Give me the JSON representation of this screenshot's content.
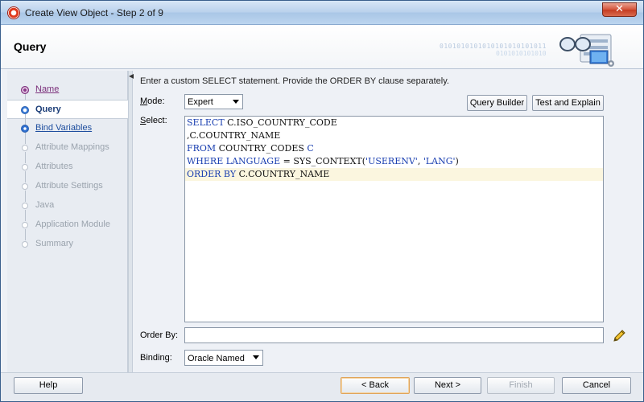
{
  "window": {
    "title": "Create View Object - Step 2 of 9",
    "close_label": "✕"
  },
  "header": {
    "title": "Query",
    "binary_a": "0101010101010101010101011",
    "binary_b": "0101010101010"
  },
  "steps": [
    {
      "label": "Name",
      "state": "done"
    },
    {
      "label": "Query",
      "state": "current"
    },
    {
      "label": "Bind Variables",
      "state": "next"
    },
    {
      "label": "Attribute Mappings",
      "state": "future"
    },
    {
      "label": "Attributes",
      "state": "future"
    },
    {
      "label": "Attribute Settings",
      "state": "future"
    },
    {
      "label": "Java",
      "state": "future"
    },
    {
      "label": "Application Module",
      "state": "future"
    },
    {
      "label": "Summary",
      "state": "future"
    }
  ],
  "content": {
    "instruction": "Enter a custom SELECT statement. Provide the ORDER BY clause separately.",
    "mode_label_key": "M",
    "mode_label_rest": "ode:",
    "mode_value": "Expert",
    "query_builder": "Query Builder",
    "test_explain": "Test and Explain",
    "select_label_key": "S",
    "select_label_rest": "elect:",
    "query_lines": [
      {
        "parts": [
          {
            "t": "SELECT ",
            "c": "kw"
          },
          {
            "t": "C.ISO_COUNTRY_CODE",
            "c": "plain"
          }
        ]
      },
      {
        "parts": [
          {
            "t": ",C.COUNTRY_NAME",
            "c": "plain"
          }
        ]
      },
      {
        "parts": [
          {
            "t": "FROM ",
            "c": "kw"
          },
          {
            "t": "COUNTRY_CODES ",
            "c": "plain"
          },
          {
            "t": "C",
            "c": "kw"
          }
        ]
      },
      {
        "parts": [
          {
            "t": "WHERE ",
            "c": "kw"
          },
          {
            "t": "LANGUAGE ",
            "c": "kw"
          },
          {
            "t": "= SYS_CONTEXT(",
            "c": "plain"
          },
          {
            "t": "'USERENV'",
            "c": "str"
          },
          {
            "t": ", ",
            "c": "plain"
          },
          {
            "t": "'LANG'",
            "c": "str"
          },
          {
            "t": ")",
            "c": "plain"
          }
        ]
      },
      {
        "parts": [
          {
            "t": "ORDER BY ",
            "c": "kw"
          },
          {
            "t": "C.COUNTRY_NAME",
            "c": "plain"
          }
        ],
        "highlight": true
      }
    ],
    "orderby_label": "Order By:",
    "orderby_value": "",
    "binding_label": "Binding:",
    "binding_value": "Oracle Named"
  },
  "footer": {
    "help": "Help",
    "back": "< Back",
    "next": "Next >",
    "finish": "Finish",
    "cancel": "Cancel"
  },
  "colors": {
    "keyword": "#1a3fb0",
    "accent": "#3b7dd8",
    "visited": "#7a2e7a"
  }
}
